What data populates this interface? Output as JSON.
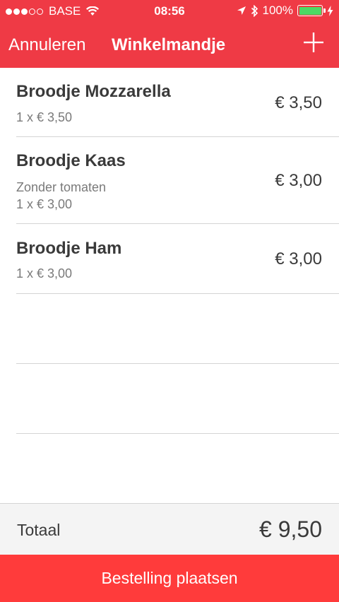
{
  "status_bar": {
    "signal_bars_filled": 3,
    "signal_bars_total": 5,
    "carrier": "BASE",
    "time": "08:56",
    "battery": "100%",
    "battery_level": 1.0,
    "battery_color": "#4cd964"
  },
  "nav": {
    "cancel_label": "Annuleren",
    "title": "Winkelmandje",
    "add_icon": "plus-icon"
  },
  "items": [
    {
      "name": "Broodje Mozzarella",
      "note": "",
      "quantity_line": "1 x € 3,50",
      "price": "€ 3,50"
    },
    {
      "name": "Broodje Kaas",
      "note": "Zonder tomaten",
      "quantity_line": "1 x € 3,00",
      "price": "€ 3,00"
    },
    {
      "name": "Broodje Ham",
      "note": "",
      "quantity_line": "1 x € 3,00",
      "price": "€ 3,00"
    }
  ],
  "footer": {
    "total_label": "Totaal",
    "total_value": "€ 9,50"
  },
  "order_button": {
    "label": "Bestelling plaatsen"
  },
  "colors": {
    "header": "#ef3a45",
    "order_button": "#ff3b3b"
  }
}
